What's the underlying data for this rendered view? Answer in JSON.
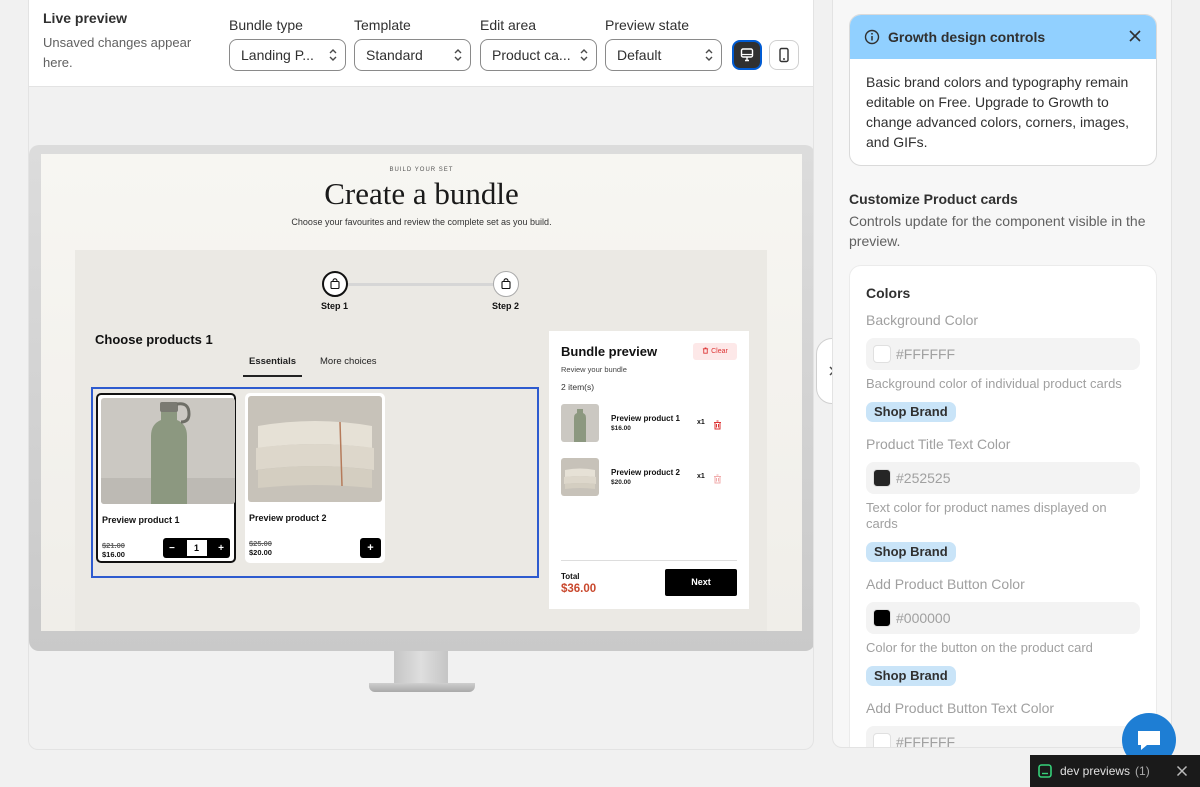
{
  "header": {
    "title": "Live preview",
    "subtitle": "Unsaved changes appear here.",
    "controls": [
      {
        "label": "Bundle type",
        "value": "Landing P..."
      },
      {
        "label": "Template",
        "value": "Standard"
      },
      {
        "label": "Edit area",
        "value": "Product ca..."
      },
      {
        "label": "Preview state",
        "value": "Default"
      }
    ]
  },
  "storefront": {
    "kicker": "BUILD YOUR SET",
    "title": "Create a bundle",
    "subtitle": "Choose your favourites and review the complete set as you build.",
    "steps": [
      "Step 1",
      "Step 2"
    ],
    "choose_title": "Choose products 1",
    "tabs": [
      "Essentials",
      "More choices"
    ],
    "products": [
      {
        "name": "Preview product 1",
        "old_price": "$21.00",
        "price": "$16.00",
        "qty": "1"
      },
      {
        "name": "Preview product 2",
        "old_price": "$25.00",
        "price": "$20.00"
      }
    ],
    "bundle": {
      "title": "Bundle preview",
      "clear": "Clear",
      "review": "Review your bundle",
      "count": "2 item(s)",
      "items": [
        {
          "name": "Preview product 1",
          "price": "$16.00",
          "qty": "x1"
        },
        {
          "name": "Preview product 2",
          "price": "$20.00",
          "qty": "x1"
        }
      ],
      "total_label": "Total",
      "total": "$36.00",
      "next": "Next"
    }
  },
  "panel": {
    "banner_title": "Growth design controls",
    "banner_body": "Basic brand colors and typography remain editable on Free. Upgrade to Growth to change advanced colors, corners, images, and GIFs.",
    "customize_title": "Customize Product cards",
    "customize_sub": "Controls update for the component visible in the preview.",
    "colors_title": "Colors",
    "fields": [
      {
        "label": "Background Color",
        "value": "#FFFFFF",
        "swatch": "#FFFFFF",
        "help": "Background color of individual product cards",
        "badge": "Shop Brand"
      },
      {
        "label": "Product Title Text Color",
        "value": "#252525",
        "swatch": "#252525",
        "help": "Text color for product names displayed on cards",
        "badge": "Shop Brand"
      },
      {
        "label": "Add Product Button Color",
        "value": "#000000",
        "swatch": "#000000",
        "help": "Color for the button on the product card",
        "badge": "Shop Brand"
      },
      {
        "label": "Add Product Button Text Color",
        "value": "#FFFFFF",
        "swatch": "#FFFFFF"
      }
    ]
  },
  "devbar": {
    "label": "dev previews",
    "count": "(1)"
  },
  "colors": {
    "accent": "#005bd3",
    "banner": "#91d0ff",
    "total": "#c9482d",
    "chat": "#1e7ed4"
  }
}
